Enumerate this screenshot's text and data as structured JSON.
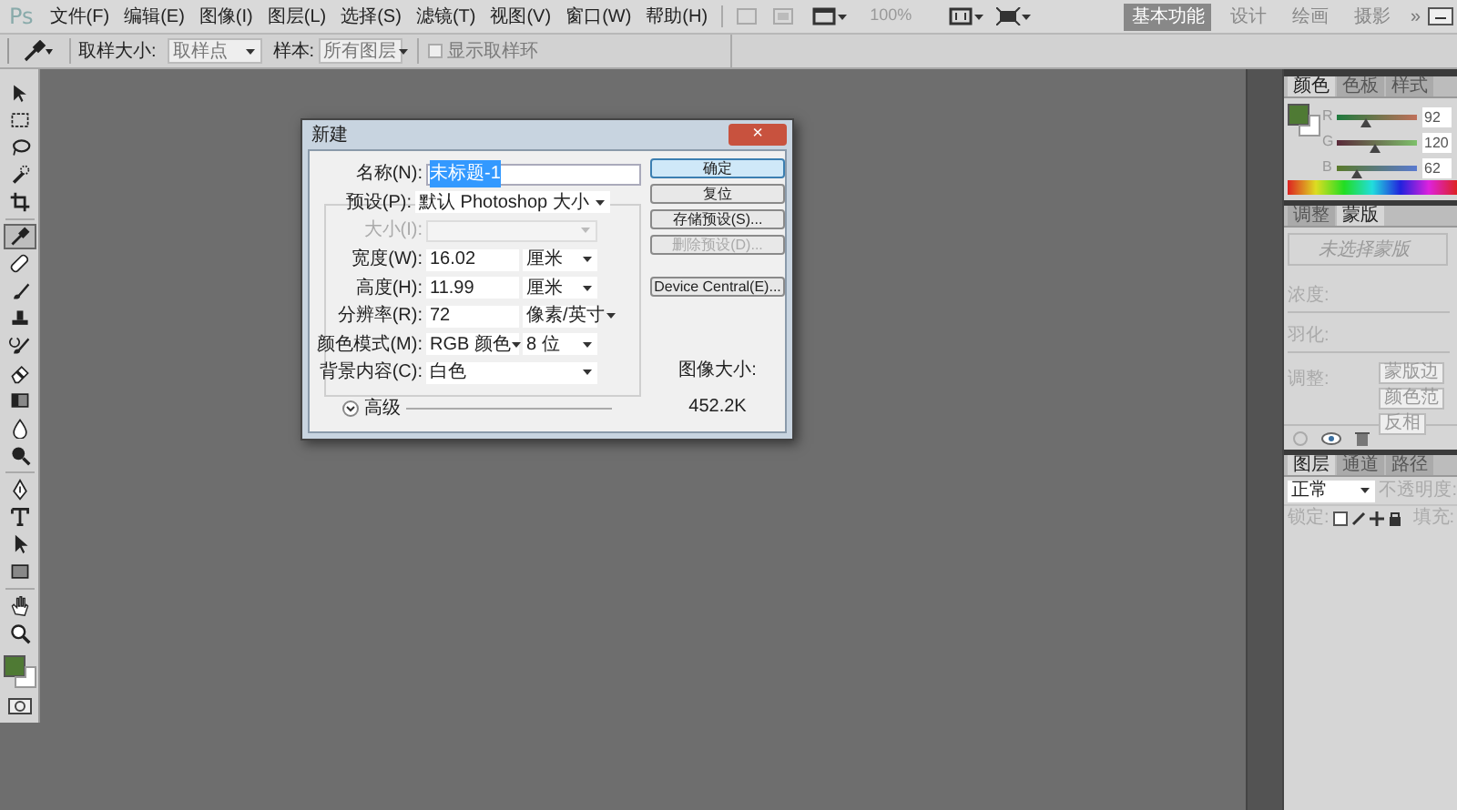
{
  "menu_bar": {
    "logo": "Ps",
    "items": [
      "文件(F)",
      "编辑(E)",
      "图像(I)",
      "图层(L)",
      "选择(S)",
      "滤镜(T)",
      "视图(V)",
      "窗口(W)",
      "帮助(H)"
    ],
    "zoom_level": "100%",
    "workspaces": [
      {
        "label": "基本功能",
        "selected": true
      },
      {
        "label": "设计",
        "selected": false
      },
      {
        "label": "绘画",
        "selected": false
      },
      {
        "label": "摄影",
        "selected": false
      }
    ],
    "more": "»"
  },
  "options_bar": {
    "sample_size_label": "取样大小:",
    "sample_size_value": "取样点",
    "sample_label": "样本:",
    "sample_value": "所有图层",
    "show_ring": {
      "label": "显示取样环",
      "checked": false,
      "disabled": true
    }
  },
  "tools": [
    {
      "kind": "move",
      "selected": false
    },
    {
      "kind": "marquee",
      "selected": false
    },
    {
      "kind": "lasso",
      "selected": false
    },
    {
      "kind": "quick-select",
      "selected": false
    },
    {
      "kind": "crop",
      "selected": false
    },
    {
      "kind": "eyedropper",
      "selected": true
    },
    {
      "kind": "healing",
      "selected": false
    },
    {
      "kind": "brush",
      "selected": false
    },
    {
      "kind": "stamp",
      "selected": false
    },
    {
      "kind": "history-brush",
      "selected": false
    },
    {
      "kind": "eraser",
      "selected": false
    },
    {
      "kind": "gradient",
      "selected": false
    },
    {
      "kind": "blur",
      "selected": false
    },
    {
      "kind": "dodge",
      "selected": false
    },
    {
      "kind": "pen",
      "selected": false
    },
    {
      "kind": "type",
      "selected": false
    },
    {
      "kind": "path-select",
      "selected": false
    },
    {
      "kind": "shape",
      "selected": false
    },
    {
      "kind": "hand",
      "selected": false
    },
    {
      "kind": "zoom",
      "selected": false
    }
  ],
  "dialog": {
    "title": "新建",
    "close": "×",
    "fields": [
      {
        "kind": "text",
        "label": "名称(N):",
        "value": "未标题-1",
        "selected": true,
        "disabled": false
      },
      {
        "kind": "preset",
        "label": "预设(P):",
        "value": "默认 Photoshop 大小",
        "disabled": false
      },
      {
        "kind": "select",
        "label": "大小(I):",
        "disabled": true
      },
      {
        "kind": "number",
        "label": "宽度(W):",
        "value": "16.02",
        "unit": "厘米",
        "disabled": false
      },
      {
        "kind": "number",
        "label": "高度(H):",
        "value": "11.99",
        "unit": "厘米",
        "disabled": false
      },
      {
        "kind": "number",
        "label": "分辨率(R):",
        "value": "72",
        "unit": "像素/英寸",
        "disabled": false
      },
      {
        "kind": "pair",
        "label": "颜色模式(M):",
        "value": "RGB 颜色",
        "unit": "8 位",
        "disabled": false
      },
      {
        "kind": "select",
        "label": "背景内容(C):",
        "value": "白色",
        "disabled": false
      }
    ],
    "advanced": {
      "label": "高级",
      "expanded": false
    },
    "buttons": [
      {
        "label": "确定",
        "default": true,
        "disabled": false
      },
      {
        "label": "复位",
        "default": false,
        "disabled": false
      },
      {
        "label": "存储预设(S)...",
        "default": false,
        "disabled": false
      },
      {
        "label": "删除预设(D)...",
        "default": false,
        "disabled": true
      },
      {
        "label": "Device Central(E)...",
        "default": false,
        "disabled": false
      }
    ],
    "image_size_label": "图像大小:",
    "image_size_value": "452.2K"
  },
  "color_panel": {
    "tabs": [
      {
        "label": "颜色",
        "selected": true
      },
      {
        "label": "色板",
        "selected": false
      },
      {
        "label": "样式",
        "selected": false
      }
    ],
    "channels": [
      {
        "label": "R",
        "value": "92",
        "level": 0.36
      },
      {
        "label": "G",
        "value": "120",
        "level": 0.47
      },
      {
        "label": "B",
        "value": "62",
        "level": 0.24
      }
    ]
  },
  "masks_panel": {
    "tabs": [
      {
        "label": "调整",
        "selected": false
      },
      {
        "label": "蒙版",
        "selected": true
      }
    ],
    "status": "未选择蒙版",
    "density_label": "浓度:",
    "feather_label": "羽化:",
    "refine_label": "调整:",
    "buttons": [
      "蒙版边",
      "颜色范",
      "反相"
    ]
  },
  "layers_panel": {
    "tabs": [
      {
        "label": "图层",
        "selected": true
      },
      {
        "label": "通道",
        "selected": false
      },
      {
        "label": "路径",
        "selected": false
      }
    ],
    "blend_mode": "正常",
    "opacity_label": "不透明度:",
    "lock_label": "锁定:",
    "fill_label": "填充:"
  }
}
